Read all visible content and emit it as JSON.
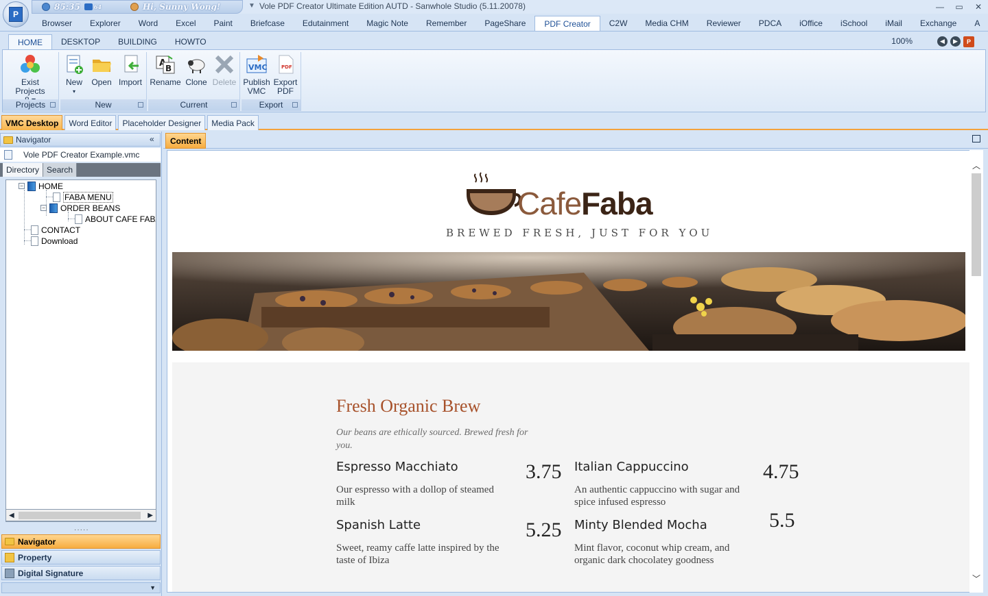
{
  "window": {
    "title": "Vole PDF Creator Ultimate Edition AUTD - Sanwhole Studio (5.11.20078)",
    "qat_time": "85:35",
    "qat_badge": "64",
    "qat_greeting": "Hi, Sunny Wong!",
    "app_button_letter": "P"
  },
  "app_tabs": [
    "Browser",
    "Explorer",
    "Word",
    "Excel",
    "Paint",
    "Briefcase",
    "Edutainment",
    "Magic Note",
    "Remember",
    "PageShare",
    "PDF Creator",
    "C2W",
    "Media CHM",
    "Reviewer",
    "PDCA",
    "iOffice",
    "iSchool",
    "iMail",
    "Exchange",
    "A"
  ],
  "active_app_tab": "PDF Creator",
  "ribbon_tabs": [
    "HOME",
    "DESKTOP",
    "BUILDING",
    "HOWTO"
  ],
  "zoom": "100%",
  "ribbon": {
    "projects": {
      "label": "Projects",
      "exist_projects": "Exist Projects",
      "count": "8"
    },
    "new": {
      "label": "New",
      "new": "New",
      "open": "Open",
      "import": "Import"
    },
    "current": {
      "label": "Current",
      "rename": "Rename",
      "clone": "Clone",
      "delete": "Delete"
    },
    "export": {
      "label": "Export",
      "publish_line1": "Publish",
      "publish_line2": "VMC",
      "export_line1": "Export",
      "export_line2": "PDF",
      "vmc_icon_text": "VMC",
      "pdf_icon_text": "PDF"
    }
  },
  "doc_tabs": [
    "VMC Desktop",
    "Word Editor",
    "Placeholder Designer",
    "Media Pack"
  ],
  "navigator": {
    "title": "Navigator",
    "file": "Vole PDF Creator Example.vmc",
    "subtabs": [
      "Directory",
      "Search"
    ],
    "tree": {
      "home": "HOME",
      "faba_menu": "FABA MENU",
      "order_beans": "ORDER BEANS",
      "about": "ABOUT CAFE FABA",
      "contact": "CONTACT",
      "download": "Download"
    },
    "panels": [
      "Navigator",
      "Property",
      "Digital Signature"
    ]
  },
  "content": {
    "tab": "Content",
    "logo_part1": "Cafe",
    "logo_part2": "Faba",
    "tagline": "BREWED FRESH, JUST FOR YOU",
    "menu_title": "Fresh Organic Brew",
    "menu_subtitle": "Our beans are ethically sourced. Brewed fresh for you.",
    "items": [
      {
        "name": "Espresso Macchiato",
        "price": "3.75",
        "desc": "Our espresso with a dollop of steamed milk"
      },
      {
        "name": "Italian Cappuccino",
        "price": "4.75",
        "desc": "An authentic cappuccino with sugar and spice infused espresso"
      },
      {
        "name": "Spanish Latte",
        "price": "5.25",
        "desc": "Sweet, reamy caffe latte inspired by the taste of Ibiza"
      },
      {
        "name": "Minty Blended Mocha",
        "price": "5.5",
        "desc": "Mint flavor, coconut whip cream, and organic dark chocolatey goodness"
      }
    ]
  },
  "colors": {
    "accent_orange": "#f7ad40",
    "menu_title": "#a7512a",
    "logo_dark": "#3b2416",
    "logo_light": "#8b5a3c"
  }
}
